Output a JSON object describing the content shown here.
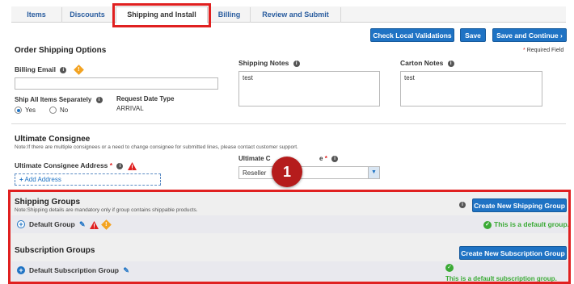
{
  "tabs": [
    {
      "label": "Items"
    },
    {
      "label": "Discounts"
    },
    {
      "label": "Shipping and Install"
    },
    {
      "label": "Billing"
    },
    {
      "label": "Review and Submit"
    }
  ],
  "toolbar": {
    "check_label": "Check Local Validations",
    "save_label": "Save",
    "save_continue_label": "Save and Continue ›"
  },
  "order_shipping": {
    "title": "Order Shipping Options",
    "required_note": "Required Field",
    "billing_email_label": "Billing Email",
    "billing_email_value": "",
    "shipping_notes_label": "Shipping Notes",
    "shipping_notes_value": "test",
    "carton_notes_label": "Carton Notes",
    "carton_notes_value": "test",
    "ship_all_label": "Ship All Items Separately",
    "radio_yes": "Yes",
    "radio_no": "No",
    "request_date_type_label": "Request Date Type",
    "request_date_type_value": "ARRIVAL"
  },
  "consignee": {
    "title": "Ultimate Consignee",
    "note": "Note:If there are multiple consignees or a need to change consignee for submitted lines, please contact customer support.",
    "address_label": "Ultimate Consignee Address",
    "add_address_label": "Add Address",
    "type_label_left": "Ultimate C",
    "type_label_right": "e",
    "type_value": "Reseller"
  },
  "callout": {
    "number": "1"
  },
  "shipping_groups": {
    "title": "Shipping Groups",
    "note": "Note:Shipping details are mandatory only if group contains shippable products.",
    "create_button": "Create New Shipping Group",
    "default_group_label": "Default Group",
    "default_status": "This is a default group."
  },
  "subscription_groups": {
    "title": "Subscription Groups",
    "create_button": "Create New Subscription Group",
    "default_group_label": "Default Subscription Group",
    "default_status": "This is a default subscription group."
  },
  "colors": {
    "accent": "#1f73c4",
    "highlight": "#e02020",
    "success": "#3aaa35",
    "warning": "#f3a321"
  }
}
